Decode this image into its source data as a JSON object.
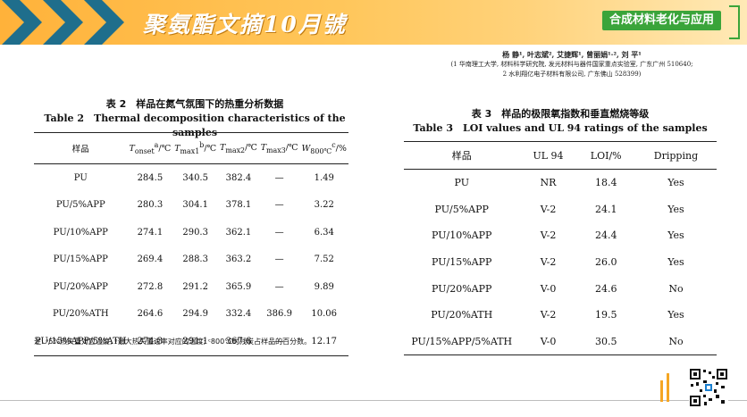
{
  "banner": {
    "title": "聚氨酯文摘10月號",
    "tag": "合成材料老化与应用"
  },
  "authors": {
    "names": "杨 静¹, 叶志斌², 艾捷辉¹, 曾丽娟¹·², 刘 平¹",
    "affil1": "(1 华南理工大学, 材料科学研究院, 发光材料与器件国家重点实验室, 广东广州 510640;",
    "affil2": "2 水利翔亿电子材料有限公司, 广东佛山 528399)"
  },
  "table2": {
    "caption_cn": "表 2　样品在氮气氛围下的热重分析数据",
    "caption_en": "Table 2　Thermal decomposition characteristics of the samples",
    "headers": [
      "样品",
      "T",
      "T",
      "T",
      "T",
      "W"
    ],
    "header_subs": [
      "",
      "onset",
      "max1",
      "max2",
      "max3",
      "800℃"
    ],
    "header_sups": [
      "",
      "a",
      "b",
      "",
      "",
      "c"
    ],
    "header_units": [
      "",
      "/℃",
      "/℃",
      "/℃",
      "/℃",
      "/%"
    ],
    "rows": [
      [
        "PU",
        "284.5",
        "340.5",
        "382.4",
        "—",
        "1.49"
      ],
      [
        "PU/5%APP",
        "280.3",
        "304.1",
        "378.1",
        "—",
        "3.22"
      ],
      [
        "PU/10%APP",
        "274.1",
        "290.3",
        "362.1",
        "—",
        "6.34"
      ],
      [
        "PU/15%APP",
        "269.4",
        "288.3",
        "363.2",
        "—",
        "7.52"
      ],
      [
        "PU/20%APP",
        "272.8",
        "291.2",
        "365.9",
        "—",
        "9.89"
      ],
      [
        "PU/20%ATH",
        "264.6",
        "294.9",
        "332.4",
        "386.9",
        "10.06"
      ],
      [
        "PU/15%APP/5%ATH",
        "274.3",
        "291.1",
        "367.6",
        "—",
        "12.17"
      ]
    ],
    "note": "注: ᵃ5%热失重对应温度; ᵇ最大热失重速率对应的温度; ᶜ800℃时残炭占样品的百分数。"
  },
  "table3": {
    "caption_cn": "表 3　样品的极限氧指数和垂直燃烧等级",
    "caption_en": "Table 3　LOI values and UL 94 ratings of the samples",
    "headers": [
      "样品",
      "UL 94",
      "LOI/%",
      "Dripping"
    ],
    "rows": [
      [
        "PU",
        "NR",
        "18.4",
        "Yes"
      ],
      [
        "PU/5%APP",
        "V-2",
        "24.1",
        "Yes"
      ],
      [
        "PU/10%APP",
        "V-2",
        "24.4",
        "Yes"
      ],
      [
        "PU/15%APP",
        "V-2",
        "26.0",
        "Yes"
      ],
      [
        "PU/20%APP",
        "V-0",
        "24.6",
        "No"
      ],
      [
        "PU/20%ATH",
        "V-2",
        "19.5",
        "Yes"
      ],
      [
        "PU/15%APP/5%ATH",
        "V-0",
        "30.5",
        "No"
      ]
    ]
  },
  "colors": {
    "banner": "#ffb23a",
    "chevron": "#1f6e8c",
    "tag": "#3aa43a"
  }
}
